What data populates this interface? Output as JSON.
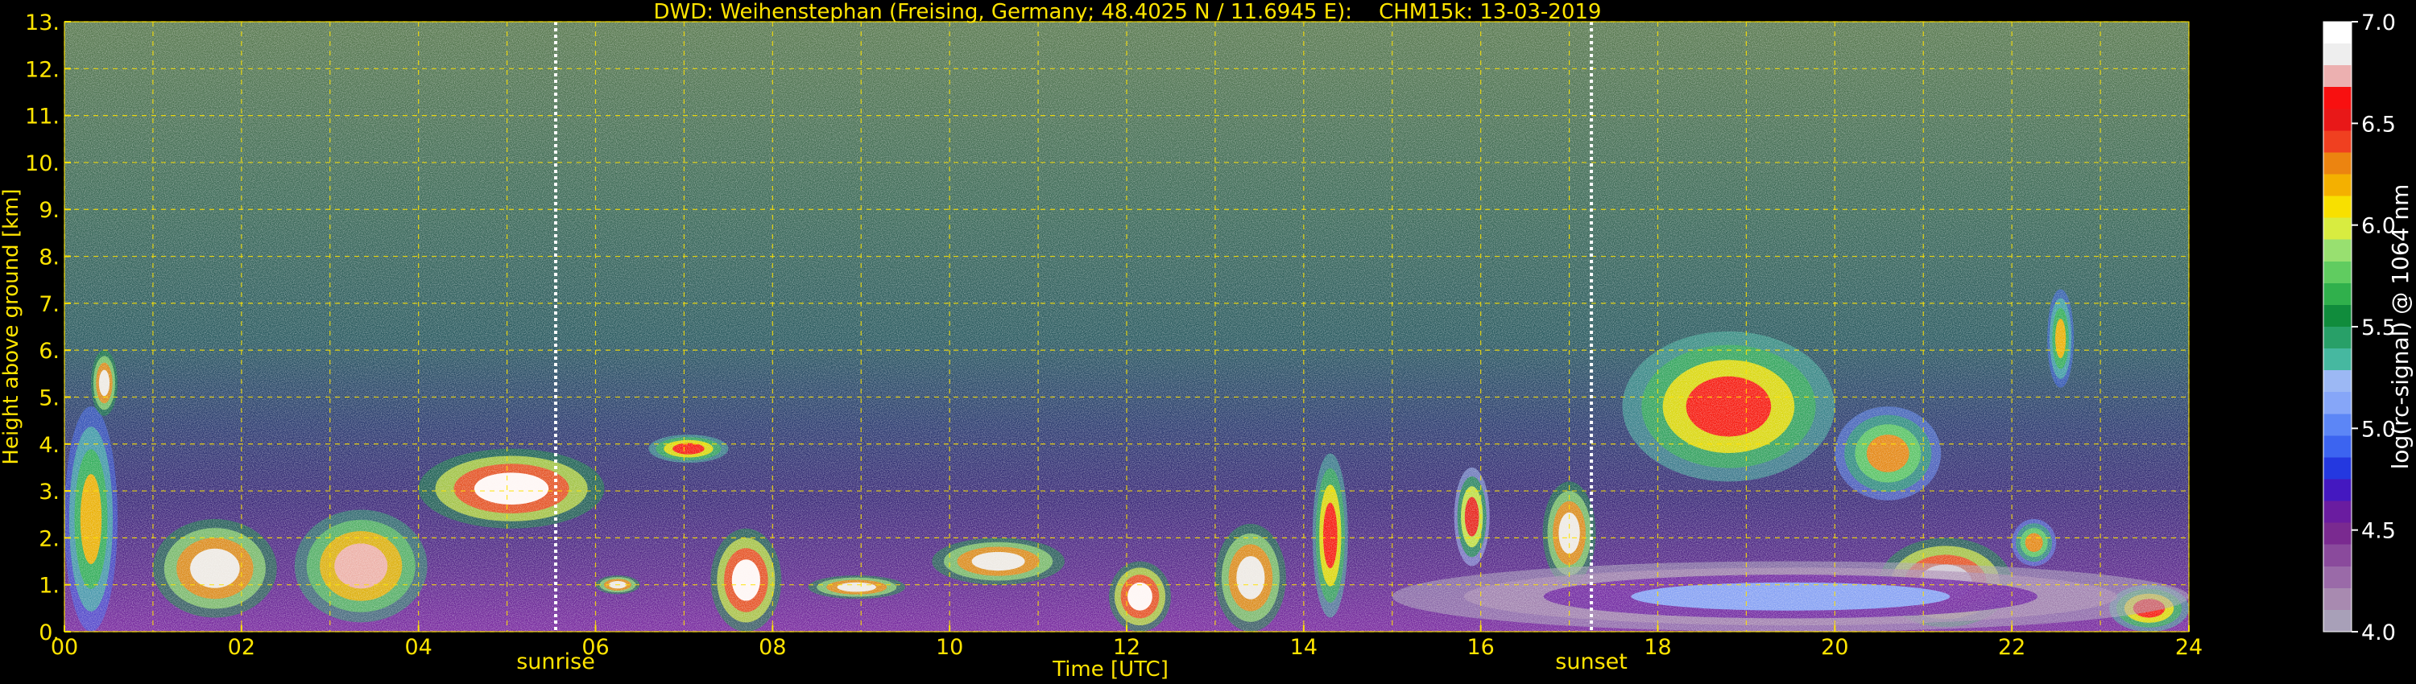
{
  "chart_data": {
    "type": "heatmap",
    "title": "DWD: Weihenstephan (Freising, Germany; 48.4025 N / 11.6945 E):    CHM15k: 13-03-2019",
    "xlabel": "Time [UTC]",
    "ylabel": "Height above ground [km]",
    "xlim": [
      0,
      24
    ],
    "ylim": [
      0,
      13
    ],
    "x_ticks": [
      "00",
      "02",
      "04",
      "06",
      "08",
      "10",
      "12",
      "14",
      "16",
      "18",
      "20",
      "22",
      "24"
    ],
    "y_ticks": [
      "0.",
      "1.",
      "2.",
      "3.",
      "4.",
      "5.",
      "6.",
      "7.",
      "8.",
      "9.",
      "10.",
      "11.",
      "12.",
      "13."
    ],
    "grid": true,
    "annotations": [
      {
        "label": "sunrise",
        "x": 5.55
      },
      {
        "label": "sunset",
        "x": 17.25
      }
    ],
    "colorbar": {
      "label": "log(rc-signal) @ 1064 nm",
      "range": [
        4.0,
        7.0
      ],
      "ticks": [
        "4.0",
        "4.5",
        "5.0",
        "5.5",
        "6.0",
        "6.5",
        "7.0"
      ],
      "colors": [
        "#a8a0b8",
        "#a88ab0",
        "#9a6aa8",
        "#8a4a9c",
        "#7a2a90",
        "#6a1ca0",
        "#4418c0",
        "#2438e0",
        "#3c64f0",
        "#5c86f6",
        "#86a6f8",
        "#9cb8f4",
        "#46b8a0",
        "#28a068",
        "#108c3c",
        "#30b04c",
        "#60cc60",
        "#98e070",
        "#d8ec40",
        "#f8e000",
        "#f4b000",
        "#ec8410",
        "#f04020",
        "#e81818",
        "#f81010",
        "#ecb0b0",
        "#eeeeee",
        "#ffffff"
      ]
    },
    "colors": {
      "background": "#000000",
      "text": "#ffe400",
      "grid": "#ffe400",
      "colorbar_text": "#ffffff"
    },
    "features": [
      {
        "kind": "aerosol_layer",
        "x": [
          0.0,
          0.6
        ],
        "top": [
          3.0,
          4.8
        ],
        "value": 6.2
      },
      {
        "kind": "elevated_layer",
        "x": [
          0.3,
          0.6
        ],
        "y": [
          4.6,
          6.0
        ],
        "value": 6.8
      },
      {
        "kind": "low_cloud",
        "x": [
          1.0,
          2.4
        ],
        "y": [
          0.3,
          2.4
        ],
        "value": 6.8
      },
      {
        "kind": "low_cloud",
        "x": [
          2.6,
          4.1
        ],
        "y": [
          0.2,
          2.6
        ],
        "value": 6.7
      },
      {
        "kind": "rising_layer",
        "x": [
          4.0,
          6.1
        ],
        "y": [
          2.2,
          3.9
        ],
        "value": 6.9
      },
      {
        "kind": "cloud",
        "x": [
          6.6,
          7.5
        ],
        "y": [
          3.6,
          4.2
        ],
        "value": 6.6
      },
      {
        "kind": "cloud",
        "x": [
          6.0,
          6.5
        ],
        "y": [
          0.8,
          1.2
        ],
        "value": 6.8
      },
      {
        "kind": "cloud",
        "x": [
          7.3,
          8.1
        ],
        "y": [
          0.0,
          2.2
        ],
        "value": 6.9
      },
      {
        "kind": "cloud",
        "x": [
          8.4,
          9.5
        ],
        "y": [
          0.7,
          1.2
        ],
        "value": 6.8
      },
      {
        "kind": "cloud",
        "x": [
          9.8,
          11.3
        ],
        "y": [
          1.0,
          2.0
        ],
        "value": 6.8
      },
      {
        "kind": "cloud",
        "x": [
          11.8,
          12.5
        ],
        "y": [
          0.0,
          1.5
        ],
        "value": 6.9
      },
      {
        "kind": "cloud",
        "x": [
          13.0,
          13.8
        ],
        "y": [
          0.0,
          2.3
        ],
        "value": 6.8
      },
      {
        "kind": "cloud",
        "x": [
          14.1,
          14.5
        ],
        "y": [
          0.3,
          3.8
        ],
        "value": 6.6
      },
      {
        "kind": "cloud",
        "x": [
          15.7,
          16.1
        ],
        "y": [
          1.4,
          3.5
        ],
        "value": 6.5
      },
      {
        "kind": "cloud",
        "x": [
          16.7,
          17.3
        ],
        "y": [
          1.0,
          3.2
        ],
        "value": 6.8
      },
      {
        "kind": "elevated_cloud",
        "x": [
          17.6,
          20.0
        ],
        "y": [
          3.2,
          6.4
        ],
        "value": 6.6
      },
      {
        "kind": "elevated_cloud",
        "x": [
          20.0,
          21.2
        ],
        "y": [
          2.8,
          4.8
        ],
        "value": 6.3
      },
      {
        "kind": "low_cloud",
        "x": [
          20.5,
          22.0
        ],
        "y": [
          0.1,
          2.0
        ],
        "value": 6.9
      },
      {
        "kind": "small_cloud",
        "x": [
          22.4,
          22.7
        ],
        "y": [
          5.2,
          7.3
        ],
        "value": 6.2
      },
      {
        "kind": "small_cloud",
        "x": [
          22.0,
          22.5
        ],
        "y": [
          1.4,
          2.4
        ],
        "value": 6.3
      },
      {
        "kind": "low_cloud",
        "x": [
          23.1,
          24.0
        ],
        "y": [
          0.0,
          1.0
        ],
        "value": 6.6
      },
      {
        "kind": "boundary_layer",
        "x": [
          15.0,
          24.0
        ],
        "y": [
          0.0,
          1.5
        ],
        "value": 5.1
      }
    ]
  }
}
